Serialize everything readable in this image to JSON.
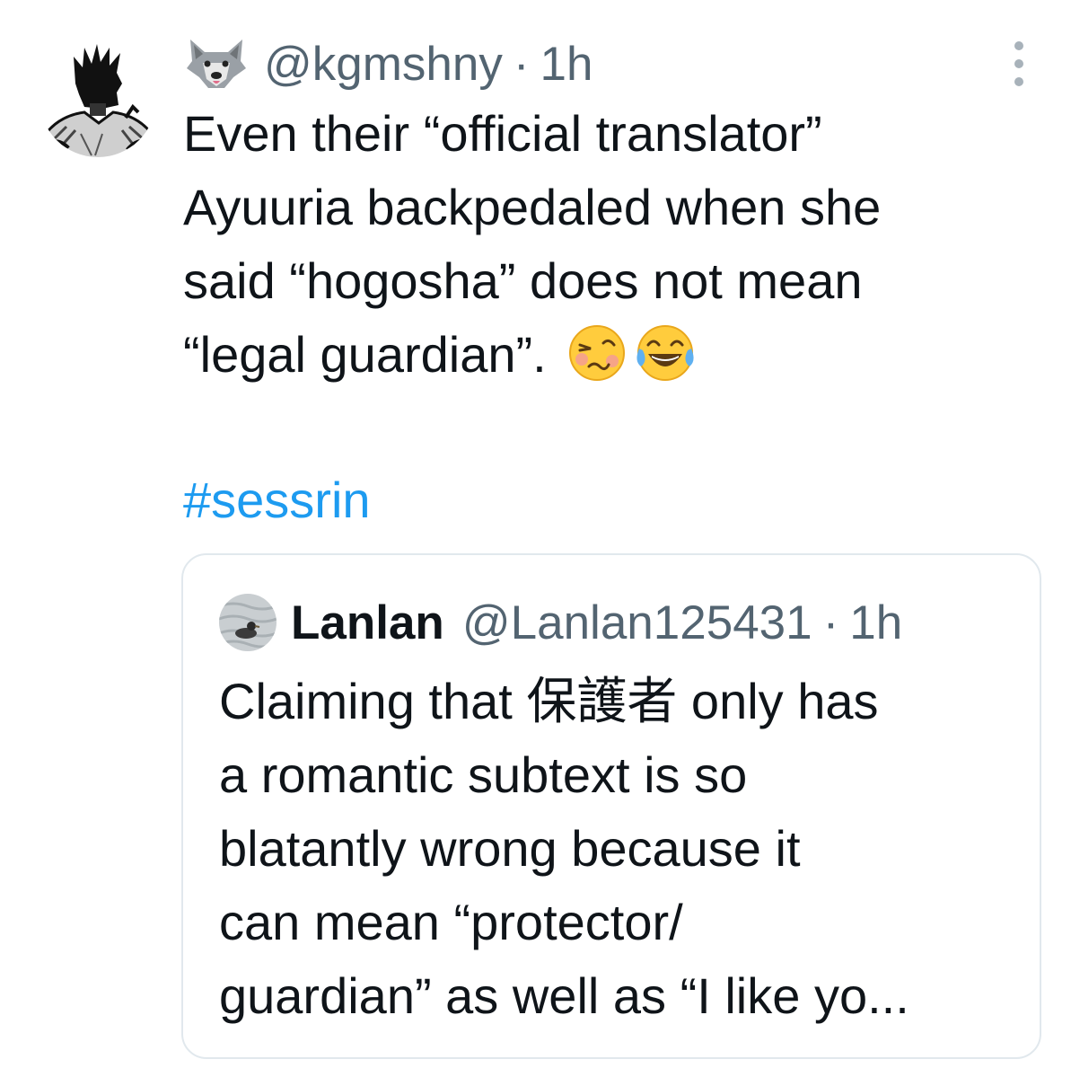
{
  "tweet": {
    "author_emoji": "wolf-face-icon",
    "handle": "@kgmshny",
    "separator": "·",
    "time": "1h",
    "text_lines": [
      "Even their “official translator”",
      "Ayuuria backpedaled when she",
      "said “hogosha” does not mean",
      "“legal guardian”."
    ],
    "trailing_emojis": [
      "woozy-face-icon",
      "tears-of-joy-icon"
    ],
    "hashtag": "#sessrin"
  },
  "quoted_tweet": {
    "name": "Lanlan",
    "handle": "@Lanlan125431",
    "separator": "·",
    "time": "1h",
    "text_lines": [
      "Claiming that 保護者 only has",
      "a romantic subtext is so",
      "blatantly wrong because it",
      "can mean “protector/",
      "guardian” as well as “I like yo..."
    ]
  },
  "colors": {
    "text_primary": "#0f1419",
    "text_secondary": "#536471",
    "link": "#1d9bf0",
    "border": "#e1e8ed"
  }
}
